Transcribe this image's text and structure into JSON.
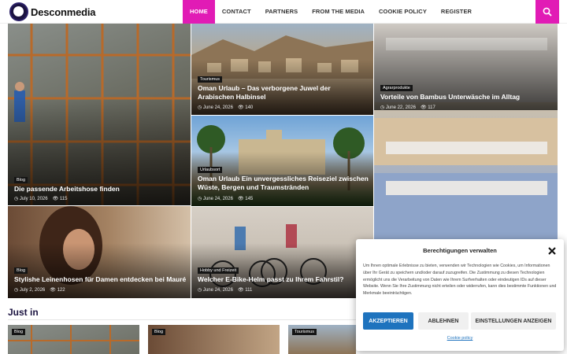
{
  "site": {
    "name": "Desconmedia"
  },
  "nav": {
    "items": [
      {
        "label": "HOME"
      },
      {
        "label": "CONTACT"
      },
      {
        "label": "PARTNERS"
      },
      {
        "label": "FROM THE MEDIA"
      },
      {
        "label": "COOKIE POLICY"
      },
      {
        "label": "REGISTER"
      }
    ],
    "active_color": "#e11bb5"
  },
  "featured": [
    {
      "tag": "Blog",
      "title": "Die passende Arbeitshose finden",
      "date": "July 10, 2026",
      "views": "115"
    },
    {
      "tag": "Tourismus",
      "title": "Oman Urlaub – Das verborgene Juwel der Arabischen Halbinsel",
      "date": "June 24, 2026",
      "views": "140"
    },
    {
      "tag": "Agrarprodukte",
      "title": "Vorteile von Bambus Unterwäsche im Alltag",
      "date": "June 22, 2026",
      "views": "117"
    },
    {
      "tag": "Urlaubsort",
      "title": "Oman Urlaub Ein unvergessliches Reiseziel zwischen Wüste, Bergen und Traumstränden",
      "date": "June 24, 2026",
      "views": "145"
    },
    {
      "tag": "Blog",
      "title": "Stylishe Leinenhosen für Damen entdecken bei Mauré",
      "date": "July 2, 2026",
      "views": "122"
    },
    {
      "tag": "Hobby und Freizeit",
      "title": "Welcher E-Bike-Helm passt zu Ihrem Fahrstil?",
      "date": "June 24, 2026",
      "views": "111"
    }
  ],
  "just_in": {
    "heading": "Just in",
    "tags": [
      "Blog",
      "Blog",
      "Tourismus"
    ]
  },
  "cookie_modal": {
    "title": "Berechtigungen verwalten",
    "text": "Um Ihnen optimale Erlebnisse zu bieten, verwenden wir Technologien wie Cookies, um Informationen über Ihr Gerät zu speichern und/oder darauf zuzugreifen. Die Zustimmung zu diesen Technologien ermöglicht uns die Verarbeitung von Daten wie Ihrem Surfverhalten oder eindeutigen IDs auf dieser Website. Wenn Sie Ihre Zustimmung nicht erteilen oder widerrufen, kann dies bestimmte Funktionen und Merkmale beeinträchtigen.",
    "accept": "AKZEPTIEREN",
    "deny": "ABLEHNEN",
    "preferences": "EINSTELLUNGEN ANZEIGEN",
    "policy_link": "Cookie policy",
    "accent": "#1e73be"
  }
}
